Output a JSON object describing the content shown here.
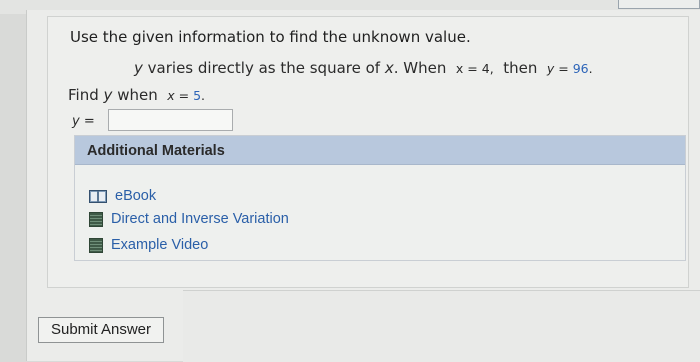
{
  "question": {
    "prompt": "Use the given information to find the unknown value.",
    "problem": {
      "var_y": "y",
      "text_varies": "varies directly as the square of",
      "var_x": "x",
      "text_when": ". When",
      "when_x": "x = 4,",
      "then": "then",
      "then_y": "y = 96."
    },
    "find": {
      "text": "Find",
      "var_y": "y",
      "when": "when",
      "when_x": "x = 5."
    },
    "answer_label": "y =",
    "answer_value": ""
  },
  "additional_materials": {
    "header": "Additional Materials",
    "items": [
      {
        "label": "eBook",
        "icon": "book-icon"
      },
      {
        "label": "Direct and Inverse Variation",
        "icon": "document-icon"
      },
      {
        "label": "Example Video",
        "icon": "video-icon"
      }
    ]
  },
  "submit": {
    "label": "Submit Answer"
  },
  "colors": {
    "link": "#2a5fa8",
    "header_bg": "#b8c8dd",
    "highlight": "#2c64b8"
  }
}
